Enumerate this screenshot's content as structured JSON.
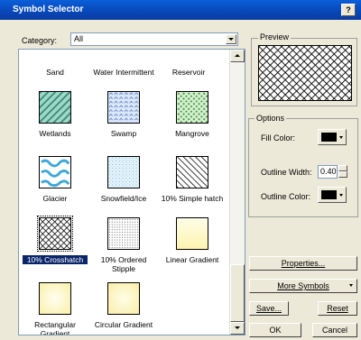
{
  "window": {
    "title": "Symbol Selector",
    "help_label": "?"
  },
  "category": {
    "label": "Category:",
    "value": "All"
  },
  "symbols": [
    {
      "label": "Sand"
    },
    {
      "label": "Water Intermittent"
    },
    {
      "label": "Reservoir"
    },
    {
      "label": "Wetlands"
    },
    {
      "label": "Swamp"
    },
    {
      "label": "Mangrove"
    },
    {
      "label": "Glacier"
    },
    {
      "label": "Snowfield/Ice"
    },
    {
      "label": "10% Simple hatch"
    },
    {
      "label": "10% Crosshatch",
      "selected": true
    },
    {
      "label": "10% Ordered Stipple"
    },
    {
      "label": "Linear Gradient"
    },
    {
      "label": "Rectangular Gradient"
    },
    {
      "label": "Circular Gradient"
    }
  ],
  "preview": {
    "label": "Preview"
  },
  "options": {
    "label": "Options",
    "fill_color_label": "Fill Color:",
    "outline_width_label": "Outline Width:",
    "outline_width_value": "0.40",
    "outline_color_label": "Outline Color:",
    "fill_color": "#000000",
    "outline_color": "#000000"
  },
  "buttons": {
    "properties": "Properties...",
    "more_symbols": "More Symbols",
    "save": "Save...",
    "reset": "Reset",
    "ok": "OK",
    "cancel": "Cancel"
  }
}
